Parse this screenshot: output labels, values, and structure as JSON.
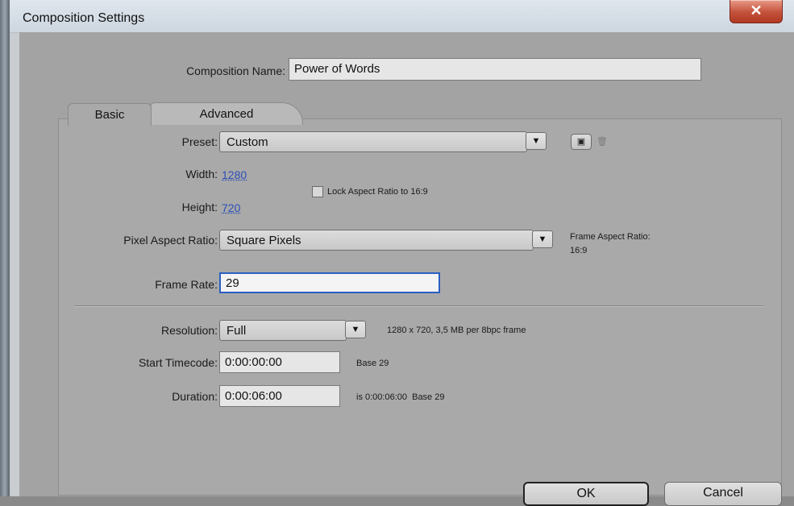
{
  "window": {
    "title": "Composition Settings",
    "close_glyph": "✕"
  },
  "composition_name": {
    "label": "Composition Name:",
    "value": "Power of Words"
  },
  "tabs": [
    {
      "label": "Basic",
      "active": true
    },
    {
      "label": "Advanced",
      "active": false
    }
  ],
  "preset": {
    "label": "Preset:",
    "value": "Custom",
    "save_icon": "save-preset-icon",
    "delete_icon": "delete-preset-icon"
  },
  "width": {
    "label": "Width:",
    "value": "1280"
  },
  "height": {
    "label": "Height:",
    "value": "720"
  },
  "lock_aspect": {
    "label": "Lock Aspect Ratio to 16:9",
    "checked": false
  },
  "pixel_aspect": {
    "label": "Pixel Aspect Ratio:",
    "value": "Square Pixels"
  },
  "frame_aspect": {
    "label": "Frame Aspect Ratio:",
    "value": "16:9"
  },
  "frame_rate": {
    "label": "Frame Rate:",
    "value": "29"
  },
  "resolution": {
    "label": "Resolution:",
    "value": "Full",
    "info": "1280 x 720, 3,5 MB per 8bpc frame"
  },
  "start_timecode": {
    "label": "Start Timecode:",
    "value": "0:00:00:00",
    "info": "Base 29"
  },
  "duration": {
    "label": "Duration:",
    "value": "0:00:06:00",
    "info": "is 0:00:06:00  Base 29"
  },
  "buttons": {
    "ok": "OK",
    "cancel": "Cancel"
  },
  "colors": {
    "accent": "#2a5fc2",
    "close": "#c4513a",
    "panel": "#a9a9a9"
  }
}
